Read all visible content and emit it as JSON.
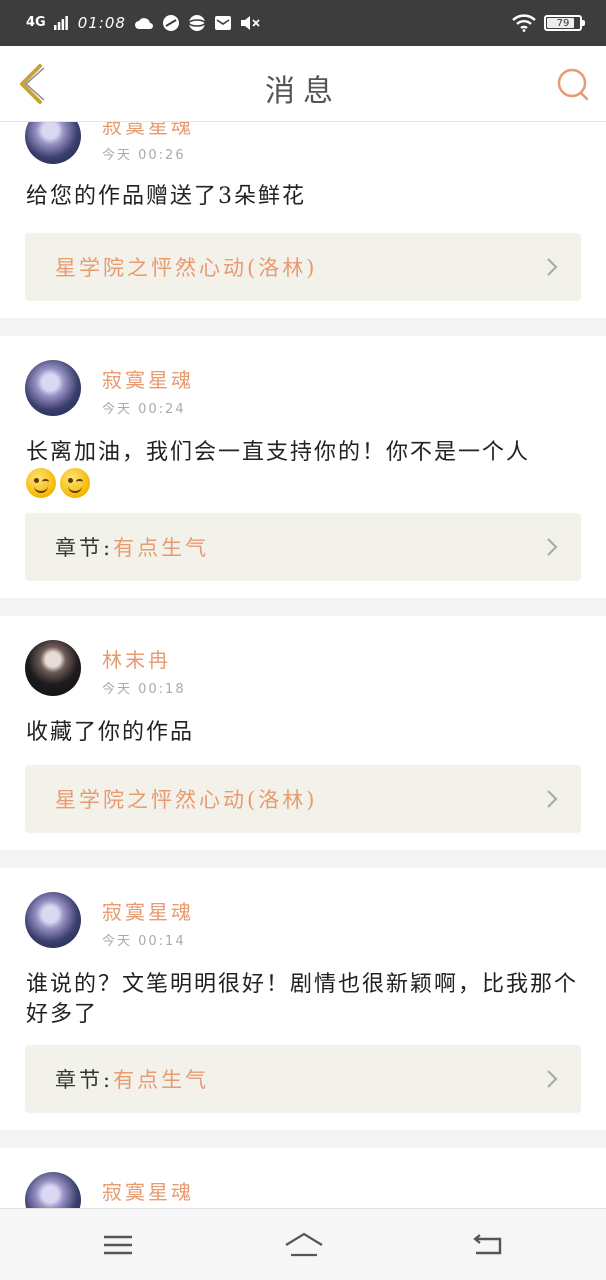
{
  "status_bar": {
    "network": "4G",
    "time": "01:08",
    "battery": "79"
  },
  "header": {
    "title": "消息"
  },
  "messages": [
    {
      "username": "寂寞星魂",
      "time": "今天 00:26",
      "content": "给您的作品赠送了3朵鲜花",
      "link_prefix": "",
      "link_text": "星学院之怦然心动(洛林)"
    },
    {
      "username": "寂寞星魂",
      "time": "今天 00:24",
      "content": "长离加油，我们会一直支持你的！你不是一个人",
      "link_prefix": "章节:",
      "link_text": "有点生气"
    },
    {
      "username": "林末冉",
      "time": "今天 00:18",
      "content": "收藏了你的作品",
      "link_prefix": "",
      "link_text": "星学院之怦然心动(洛林)"
    },
    {
      "username": "寂寞星魂",
      "time": "今天 00:14",
      "content": "谁说的？文笔明明很好！剧情也很新颖啊，比我那个好多了",
      "link_prefix": "章节:",
      "link_text": "有点生气"
    },
    {
      "username": "寂寞星魂"
    }
  ],
  "icons": {
    "back": "chevron-left-icon",
    "search": "search-icon",
    "menu": "menu-icon",
    "home": "home-icon",
    "return": "return-icon"
  },
  "colors": {
    "accent": "#e89a70",
    "back_icon": "#c9a23a",
    "link_bg": "#f3f2ea"
  }
}
